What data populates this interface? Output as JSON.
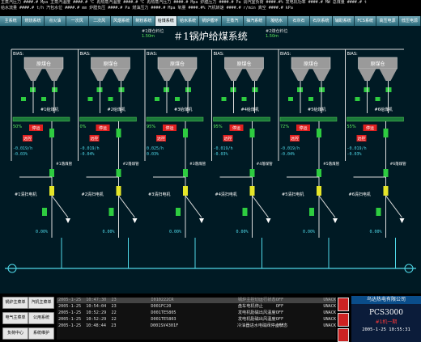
{
  "status_bar": {
    "row1": "主蒸汽压力 ####.# Mpa 主蒸汽温度 ####.# ℃ 再热蒸汽温度 ####.# ℃ 再热蒸汽压力 ####.# Mpa 炉膛压力 ####.# Pa 调汽室负荷 ####.#% 发电机功率 ####.# MW 总煤量 ####.# t",
    "row2": "给水流量 ####.# t/h 汽包水位 ####.# mm 炉膛负压 ####.# Pa 燃油压力 ####.# Mpa 氧量 ####.#% 汽机转速 ####.# r/min 真空 ####.# kPa"
  },
  "nav_tabs": [
    "主系统",
    "燃烧系统",
    "点火油",
    "一次风",
    "二次风",
    "风烟系统",
    "制粉系统",
    "给煤系统",
    "给水系统",
    "锅炉循环",
    "主蒸汽",
    "抽汽系统",
    "凝结水",
    "石灰石",
    "石灰系统",
    "辅助系统",
    "FCS系统",
    "高压电源",
    "低压电源"
  ],
  "active_tab": "给煤系统",
  "title": "＃1锅炉给煤系统",
  "levels": {
    "left_label": "#1煤仓料位",
    "left_value": "1.50m",
    "right_label": "#2煤仓料位",
    "right_value": "1.50m"
  },
  "feeders": [
    {
      "bias": "BIAS:",
      "bunker": "原煤仓",
      "name": "#1给煤机",
      "speed": "50%",
      "state": "停运",
      "local": "远控",
      "v1": "-0.019/h",
      "v2": "-0.03%",
      "rotary": "#1落煤管",
      "sweep": "#1清扫电机",
      "flow": "0.00%"
    },
    {
      "bias": "BIAS:",
      "bunker": "原煤仓",
      "name": "#2给煤机",
      "speed": "0%",
      "state": "停运",
      "local": "远控",
      "v1": "-0.019/h",
      "v2": "-0.04%",
      "rotary": "#2落煤管",
      "sweep": "#2清扫电机",
      "flow": "0.00%"
    },
    {
      "bias": "BIAS:",
      "bunker": "原煤仓",
      "name": "#3给煤机",
      "speed": "95%",
      "state": "停运",
      "local": "远控",
      "v1": "0.025/h",
      "v2": "0.03%",
      "rotary": "#3落煤管",
      "sweep": "#3清扫电机",
      "flow": "0.00%"
    },
    {
      "bias": "BIAS:",
      "bunker": "原煤仓",
      "name": "#4给煤机",
      "speed": "95%",
      "state": "停运",
      "local": "远控",
      "v1": "-0.019/h",
      "v2": "-0.03%",
      "rotary": "#4落煤管",
      "sweep": "#4清扫电机",
      "flow": "0.00%"
    },
    {
      "bias": "BIAS:",
      "bunker": "原煤仓",
      "name": "#5给煤机",
      "speed": "72%",
      "state": "停运",
      "local": "远控",
      "v1": "-0.019/h",
      "v2": "-0.04%",
      "rotary": "#5落煤管",
      "sweep": "#5清扫电机",
      "flow": "0.00%"
    },
    {
      "bias": "BIAS:",
      "bunker": "原煤仓",
      "name": "#6给煤机",
      "speed": "55%",
      "state": "停运",
      "local": "远控",
      "v1": "-0.019/h",
      "v2": "-0.03%",
      "rotary": "#6落煤管",
      "sweep": "#6清扫电机",
      "flow": "0.00%"
    }
  ],
  "left_buttons": [
    "锅炉主菜单",
    "汽机主菜单",
    "电气主菜单",
    "公用系统",
    "负荷中心",
    "系统维护"
  ],
  "alarms": {
    "header": [
      "2005-1-25",
      "10:47:30",
      "23",
      "I010222CR",
      "锅炉主控切运行状态",
      "OFF",
      "UNACK"
    ],
    "rows": [
      [
        "2005-1-25",
        "10:54:04",
        "23",
        "D001FC20",
        "盘车电机停止",
        "OFF",
        "UNACK"
      ],
      [
        "2005-1-25",
        "10:52:29",
        "22",
        "D001TE5805",
        "发电机励磁出风温度",
        "OFF",
        "UNACK"
      ],
      [
        "2005-1-25",
        "10:52:29",
        "22",
        "D001TE5803",
        "发电机励磁出风温度",
        "OFF",
        "UNACK"
      ],
      [
        "2005-1-25",
        "10:48:44",
        "23",
        "D001SV4301F",
        "冷油器进水电磁阀停止状态",
        "OFF",
        "UNACK"
      ]
    ]
  },
  "logo": {
    "company": "乌达热电有限公司",
    "system": "PCS3000",
    "unit": "#1机一期",
    "timestamp": "2005-1-25 10:55:31"
  },
  "colors": {
    "pipe": "#dcdcdc",
    "green": "#2ecc40",
    "red": "#e02020",
    "cyan": "#4fd8e8",
    "bunker": "#9a9a9a"
  }
}
